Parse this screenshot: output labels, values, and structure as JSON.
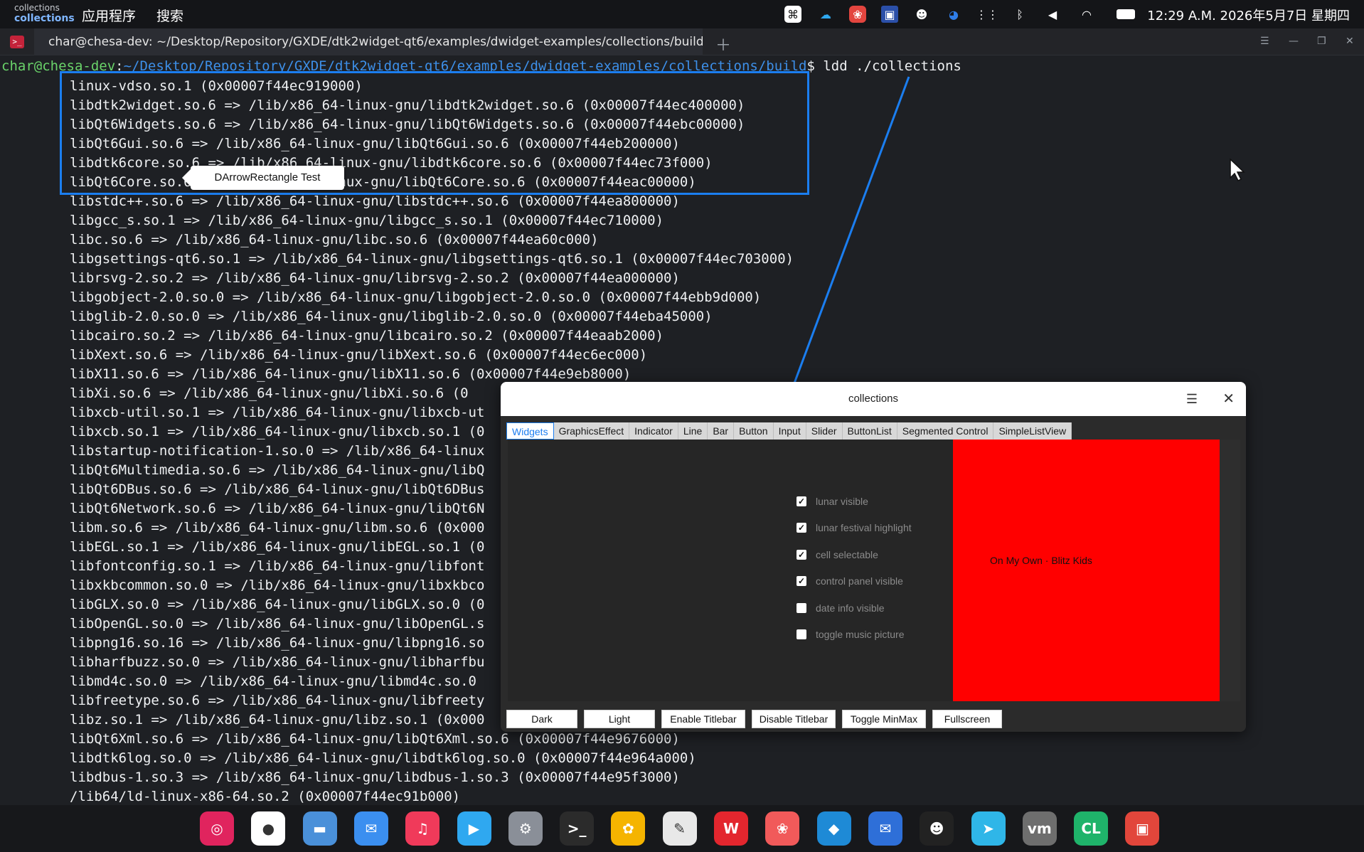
{
  "topbar": {
    "app_small": "collections",
    "app_big": "collections",
    "menu_apps": "应用程序",
    "menu_search": "搜索",
    "clock": "12:29 A.M.  2026年5月7日 星期四"
  },
  "terminal": {
    "tab_title": "char@chesa-dev: ~/Desktop/Repository/GXDE/dtk2widget-qt6/examples/dwidget-examples/collections/build",
    "prompt_user": "char@chesa-dev",
    "prompt_sep": ":",
    "prompt_path": "~/Desktop/Repository/GXDE/dtk2widget-qt6/examples/dwidget-examples/collections/build",
    "prompt_cmd": "$ ldd ./collections",
    "lines": [
      "linux-vdso.so.1 (0x00007f44ec919000)",
      "libdtk2widget.so.6 => /lib/x86_64-linux-gnu/libdtk2widget.so.6 (0x00007f44ec400000)",
      "libQt6Widgets.so.6 => /lib/x86_64-linux-gnu/libQt6Widgets.so.6 (0x00007f44ebc00000)",
      "libQt6Gui.so.6 => /lib/x86_64-linux-gnu/libQt6Gui.so.6 (0x00007f44eb200000)",
      "libdtk6core.so.6 => /lib/x86_64-linux-gnu/libdtk6core.so.6 (0x00007f44ec73f000)",
      "libQt6Core.so.6 => /lib/x86_64-linux-gnu/libQt6Core.so.6 (0x00007f44eac00000)",
      "libstdc++.so.6 => /lib/x86_64-linux-gnu/libstdc++.so.6 (0x00007f44ea800000)",
      "libgcc_s.so.1 => /lib/x86_64-linux-gnu/libgcc_s.so.1 (0x00007f44ec710000)",
      "libc.so.6 => /lib/x86_64-linux-gnu/libc.so.6 (0x00007f44ea60c000)",
      "libgsettings-qt6.so.1 => /lib/x86_64-linux-gnu/libgsettings-qt6.so.1 (0x00007f44ec703000)",
      "librsvg-2.so.2 => /lib/x86_64-linux-gnu/librsvg-2.so.2 (0x00007f44ea000000)",
      "libgobject-2.0.so.0 => /lib/x86_64-linux-gnu/libgobject-2.0.so.0 (0x00007f44ebb9d000)",
      "libglib-2.0.so.0 => /lib/x86_64-linux-gnu/libglib-2.0.so.0 (0x00007f44eba45000)",
      "libcairo.so.2 => /lib/x86_64-linux-gnu/libcairo.so.2 (0x00007f44eaab2000)",
      "libXext.so.6 => /lib/x86_64-linux-gnu/libXext.so.6 (0x00007f44ec6ec000)",
      "libX11.so.6 => /lib/x86_64-linux-gnu/libX11.so.6 (0x00007f44e9eb8000)",
      "libXi.so.6 => /lib/x86_64-linux-gnu/libXi.so.6 (0",
      "libxcb-util.so.1 => /lib/x86_64-linux-gnu/libxcb-ut",
      "libxcb.so.1 => /lib/x86_64-linux-gnu/libxcb.so.1 (0",
      "libstartup-notification-1.so.0 => /lib/x86_64-linux",
      "libQt6Multimedia.so.6 => /lib/x86_64-linux-gnu/libQ",
      "libQt6DBus.so.6 => /lib/x86_64-linux-gnu/libQt6DBus",
      "libQt6Network.so.6 => /lib/x86_64-linux-gnu/libQt6N",
      "libm.so.6 => /lib/x86_64-linux-gnu/libm.so.6 (0x000",
      "libEGL.so.1 => /lib/x86_64-linux-gnu/libEGL.so.1 (0",
      "libfontconfig.so.1 => /lib/x86_64-linux-gnu/libfont",
      "libxkbcommon.so.0 => /lib/x86_64-linux-gnu/libxkbco",
      "libGLX.so.0 => /lib/x86_64-linux-gnu/libGLX.so.0 (0",
      "libOpenGL.so.0 => /lib/x86_64-linux-gnu/libOpenGL.s",
      "libpng16.so.16 => /lib/x86_64-linux-gnu/libpng16.so",
      "libharfbuzz.so.0 => /lib/x86_64-linux-gnu/libharfbu",
      "libmd4c.so.0 => /lib/x86_64-linux-gnu/libmd4c.so.0 ",
      "libfreetype.so.6 => /lib/x86_64-linux-gnu/libfreety",
      "libz.so.1 => /lib/x86_64-linux-gnu/libz.so.1 (0x000",
      "libQt6Xml.so.6 => /lib/x86_64-linux-gnu/libQt6Xml.so.6 (0x00007f44e9676000)",
      "libdtk6log.so.0 => /lib/x86_64-linux-gnu/libdtk6log.so.0 (0x00007f44e964a000)",
      "libdbus-1.so.3 => /lib/x86_64-linux-gnu/libdbus-1.so.3 (0x00007f44e95f3000)",
      "/lib64/ld-linux-x86-64.so.2 (0x00007f44ec91b000)"
    ]
  },
  "tooltip": {
    "text": "DArrowRectangle Test"
  },
  "collections": {
    "title": "collections",
    "tabs": [
      "Widgets",
      "GraphicsEffect",
      "Indicator",
      "Line",
      "Bar",
      "Button",
      "Input",
      "Slider",
      "ButtonList",
      "Segmented Control",
      "SimpleListView"
    ],
    "checkboxes": [
      {
        "label": "lunar visible",
        "checked": true
      },
      {
        "label": "lunar festival highlight",
        "checked": true
      },
      {
        "label": "cell selectable",
        "checked": true
      },
      {
        "label": "control panel visible",
        "checked": true
      },
      {
        "label": "date info visible",
        "checked": false
      },
      {
        "label": "toggle music picture",
        "checked": false
      }
    ],
    "song": "On My Own · Blitz Kids",
    "buttons": [
      "Dark",
      "Light",
      "Enable Titlebar",
      "Disable Titlebar",
      "Toggle MinMax",
      "Fullscreen"
    ]
  },
  "colors": {
    "accent": "#1b7ef0",
    "prompt_user": "#6ad36a",
    "panel_red": "#ff0000"
  },
  "tray_icons": [
    "command-icon",
    "cloud-icon",
    "app-store-icon",
    "screen-icon",
    "penguin-icon",
    "chrome-icon",
    "grid-icon",
    "bluetooth-icon",
    "volume-icon",
    "wifi-icon",
    "battery-icon"
  ],
  "dock_icons": [
    {
      "name": "launcher-icon",
      "glyph": "◎",
      "color": "#e0245e"
    },
    {
      "name": "chrome-icon",
      "glyph": "●",
      "color": "#ffffff"
    },
    {
      "name": "files-icon",
      "glyph": "▬",
      "color": "#4a90d9"
    },
    {
      "name": "mail-icon",
      "glyph": "✉",
      "color": "#3b8ff0"
    },
    {
      "name": "music-icon",
      "glyph": "♫",
      "color": "#f03a5a"
    },
    {
      "name": "video-icon",
      "glyph": "▶",
      "color": "#2fa8f0"
    },
    {
      "name": "settings-icon",
      "glyph": "⚙",
      "color": "#8a8f98"
    },
    {
      "name": "terminal-icon",
      "glyph": ">_",
      "color": "#2b2b2b"
    },
    {
      "name": "photos-icon",
      "glyph": "✿",
      "color": "#f5b400"
    },
    {
      "name": "text-editor-icon",
      "glyph": "✎",
      "color": "#e8e8e8"
    },
    {
      "name": "wps-icon",
      "glyph": "W",
      "color": "#e3262e"
    },
    {
      "name": "app-store-icon",
      "glyph": "❀",
      "color": "#f15a5a"
    },
    {
      "name": "vscode-icon",
      "glyph": "◆",
      "color": "#1e8ad6"
    },
    {
      "name": "mail-client-icon",
      "glyph": "✉",
      "color": "#2e6fd8"
    },
    {
      "name": "qq-icon",
      "glyph": "☻",
      "color": "#222222"
    },
    {
      "name": "feishu-icon",
      "glyph": "➤",
      "color": "#2fb6e8"
    },
    {
      "name": "vmware-icon",
      "glyph": "vm",
      "color": "#6e6e6e"
    },
    {
      "name": "clion-icon",
      "glyph": "CL",
      "color": "#1fb36a"
    },
    {
      "name": "app-icon",
      "glyph": "▣",
      "color": "#e2463b"
    }
  ]
}
